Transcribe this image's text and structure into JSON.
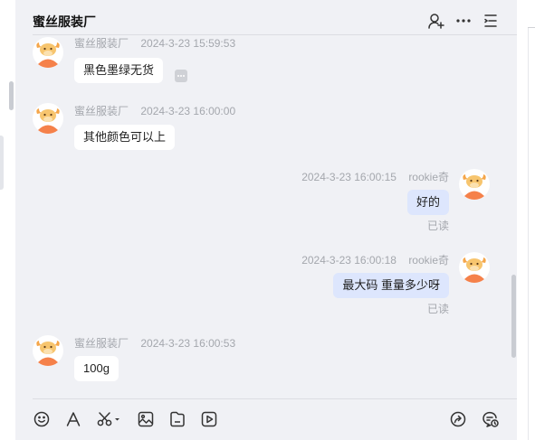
{
  "header": {
    "title": "蜜丝服装厂",
    "icons": [
      "add-member-icon",
      "more-icon",
      "menu-list-icon"
    ]
  },
  "messages": [
    {
      "direction": "in",
      "sender": "蜜丝服装厂",
      "time": "2024-3-23 15:59:53",
      "text": "黑色墨绿无货"
    },
    {
      "direction": "in",
      "sender": "蜜丝服装厂",
      "time": "2024-3-23 16:00:00",
      "text": "其他颜色可以上"
    },
    {
      "direction": "out",
      "sender": "rookie奇",
      "time": "2024-3-23 16:00:15",
      "text": "好的",
      "status": "已读"
    },
    {
      "direction": "out",
      "sender": "rookie奇",
      "time": "2024-3-23 16:00:18",
      "text": "最大码 重量多少呀",
      "status": "已读"
    },
    {
      "direction": "in",
      "sender": "蜜丝服装厂",
      "time": "2024-3-23 16:00:53",
      "text": "100g"
    }
  ],
  "toolbar": {
    "left": [
      "emoji-icon",
      "font-icon",
      "scissors-icon",
      "image-icon",
      "file-icon",
      "video-icon"
    ],
    "right": [
      "share-icon",
      "chat-history-icon"
    ]
  },
  "colors": {
    "panel_bg": "#f0f1f5",
    "bubble_in": "#ffffff",
    "bubble_out": "#dde6fd",
    "avatar_orange": "#f5814a"
  }
}
